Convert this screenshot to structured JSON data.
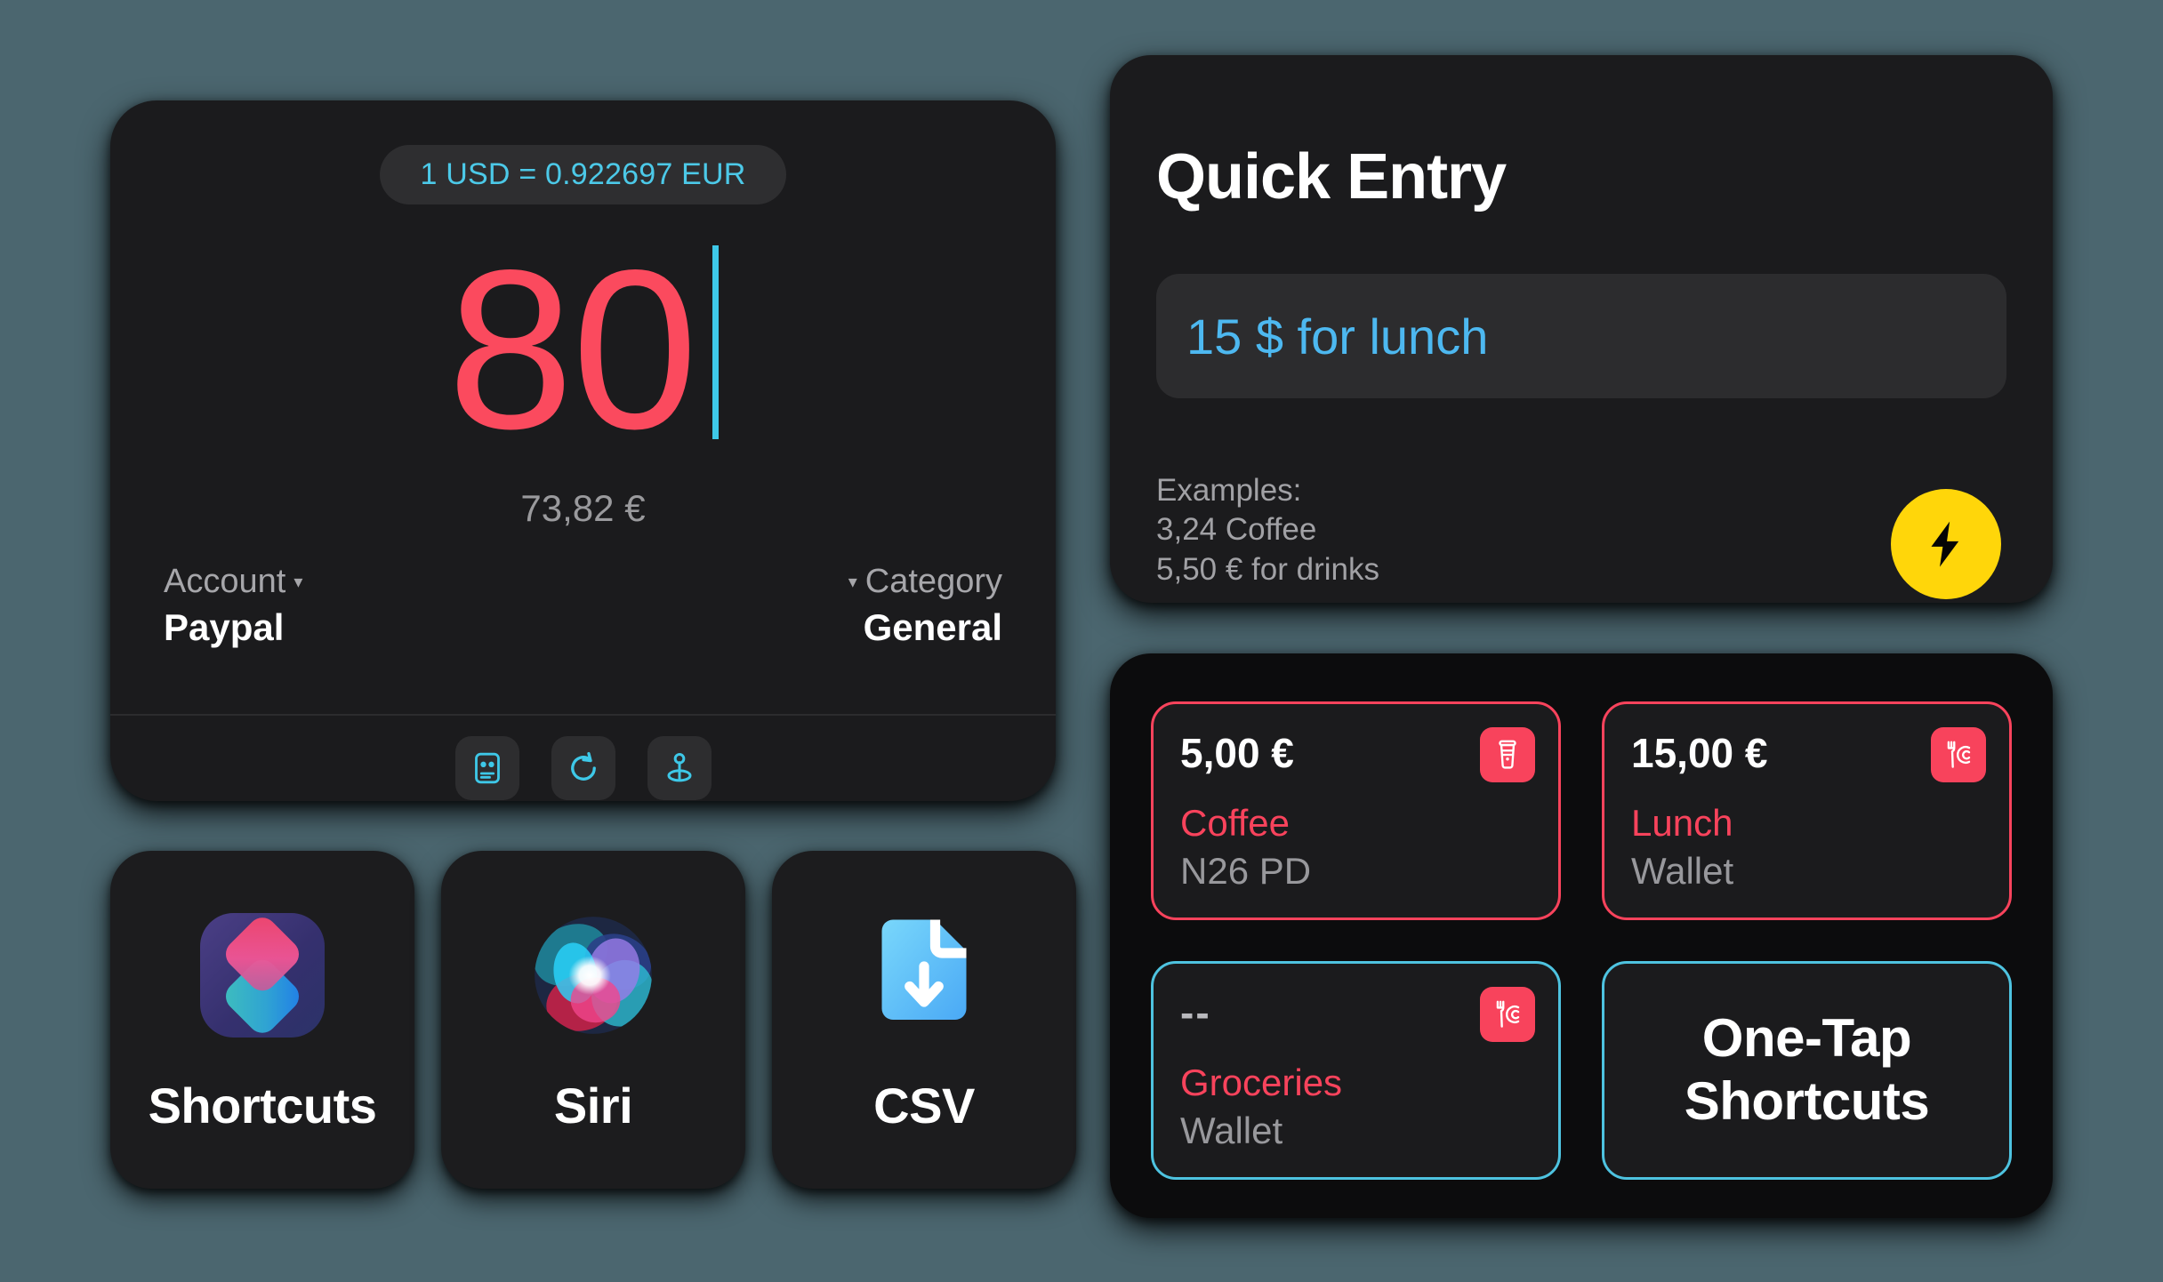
{
  "theme": {
    "background": "#4b666f",
    "card_bg": "#1c1c1e",
    "accent_cyan": "#4cc9e8",
    "accent_red": "#fb4a5e",
    "accent_yellow": "#ffd60a",
    "muted_text": "#9a9a9d"
  },
  "calculator": {
    "exchange_rate": "1 USD = 0.922697 EUR",
    "amount": "80",
    "converted_amount": "73,82 €",
    "account_label": "Account",
    "account_caret": "▾",
    "account_value": "Paypal",
    "category_label": "Category",
    "category_caret": "▾",
    "category_value": "General",
    "tools": [
      {
        "name": "note-icon"
      },
      {
        "name": "refresh-icon"
      },
      {
        "name": "location-pin-icon"
      }
    ]
  },
  "quick_entry": {
    "title": "Quick Entry",
    "input_value": "15 $ for lunch",
    "examples_heading": "Examples:",
    "examples": [
      "3,24 Coffee",
      "5,50 € for drinks"
    ],
    "run_button_icon": "lightning-bolt-icon"
  },
  "app_tiles": [
    {
      "label": "Shortcuts",
      "icon": "shortcuts-app-icon"
    },
    {
      "label": "Siri",
      "icon": "siri-orb-icon"
    },
    {
      "label": "CSV",
      "icon": "csv-download-icon"
    }
  ],
  "shortcut_grid": [
    {
      "amount": "5,00 €",
      "category": "Coffee",
      "account": "N26 PD",
      "badge_icon": "coffee-cup-icon",
      "border": "red"
    },
    {
      "amount": "15,00 €",
      "category": "Lunch",
      "account": "Wallet",
      "badge_icon": "fork-plate-icon",
      "border": "red"
    },
    {
      "amount": "--",
      "category": "Groceries",
      "account": "Wallet",
      "badge_icon": "fork-plate-icon",
      "border": "cyan"
    },
    {
      "label_line_1": "One-Tap",
      "label_line_2": "Shortcuts",
      "border": "cyan"
    }
  ]
}
